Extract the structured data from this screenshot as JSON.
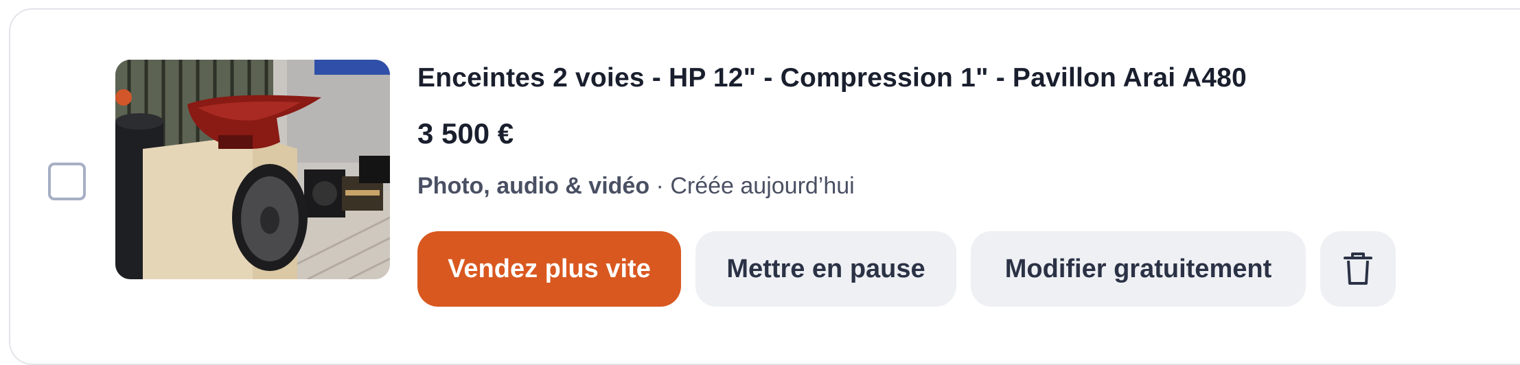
{
  "listing": {
    "title": "Enceintes 2 voies - HP 12\" - Compression 1\" - Pavillon Arai A480",
    "price": "3 500 €",
    "category": "Photo, audio & vidéo",
    "separator": " · ",
    "created": "Créée aujourd’hui",
    "thumbnail_alt": "speaker-photo"
  },
  "actions": {
    "boost_label": "Vendez plus vite",
    "pause_label": "Mettre en pause",
    "edit_label": "Modifier gratuitement",
    "delete_icon": "trash-icon"
  },
  "colors": {
    "accent": "#d9581f",
    "secondary_bg": "#eef0f4",
    "text": "#1a1f2e",
    "muted": "#4a5063",
    "checkbox_border": "#a6afc4"
  }
}
